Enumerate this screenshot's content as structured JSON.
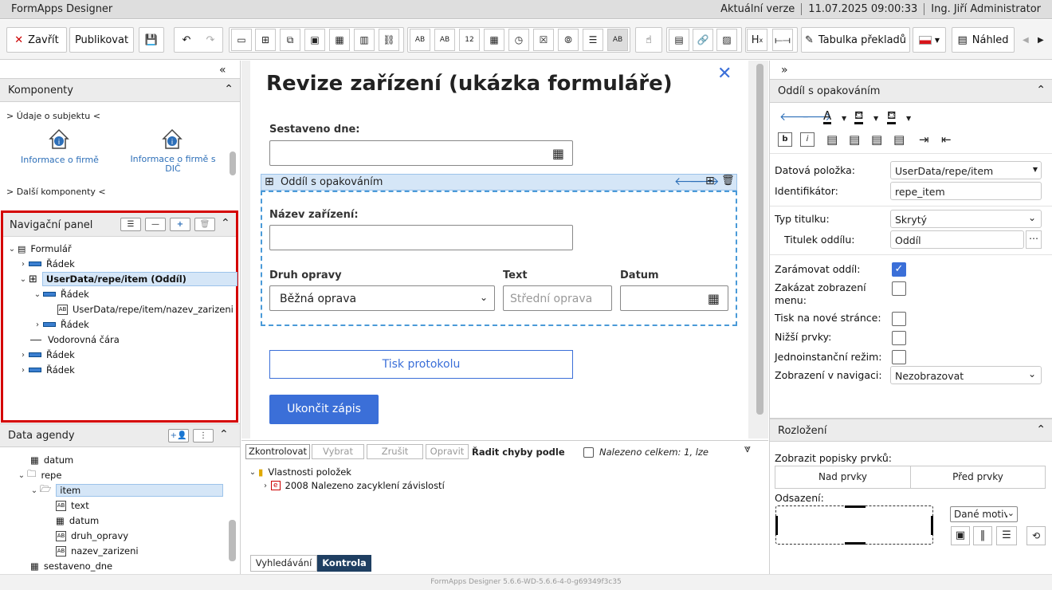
{
  "titlebar": {
    "app": "FormApps Designer",
    "version": "Aktuální verze",
    "datetime": "11.07.2025 09:00:33",
    "user": "Ing. Jiří Administrator"
  },
  "toolbar": {
    "close": "Zavřít",
    "publish": "Publikovat",
    "translations": "Tabulka překladů",
    "preview": "Náhled",
    "undo_icon": "undo-icon",
    "redo_icon": "redo-icon"
  },
  "components": {
    "title": "Komponenty",
    "group1": "> Údaje o subjektu <",
    "item1": "Informace o firmě",
    "item2": "Informace o firmě s DIČ",
    "group2": "> Další komponenty <"
  },
  "nav": {
    "title": "Navigační panel",
    "items": [
      "Formulář",
      "Řádek",
      "UserData/repe/item (Oddíl)",
      "Řádek",
      "UserData/repe/item/nazev_zarizeni",
      "Řádek",
      "Vodorovná čára",
      "Řádek",
      "Řádek"
    ]
  },
  "agenda": {
    "title": "Data agendy",
    "items": [
      "datum",
      "repe",
      "item",
      "text",
      "datum",
      "druh_opravy",
      "nazev_zarizeni",
      "sestaveno_dne"
    ]
  },
  "form": {
    "title": "Revize zařízení (ukázka formuláře)",
    "sestaveno": "Sestaveno dne:",
    "section": "Oddíl s opakováním",
    "nazev": "Název zařízení:",
    "druh": "Druh opravy",
    "druh_value": "Běžná oprava",
    "text_label": "Text",
    "text_placeholder": "Střední oprava",
    "datum": "Datum",
    "print": "Tisk protokolu",
    "finish": "Ukončit zápis"
  },
  "check": {
    "btn_check": "Zkontrolovat",
    "btn_select": "Vybrat",
    "btn_cancel": "Zrušit",
    "btn_fix": "Opravit",
    "sort": "Řadit chyby podle",
    "found": "Nalezeno celkem: 1, lze",
    "tree1": "Vlastnosti položek",
    "tree2": "2008 Nalezeno zacyklení závislostí",
    "tab_search": "Vyhledávání",
    "tab_check": "Kontrola"
  },
  "props": {
    "title": "Oddíl s opakováním",
    "data_label": "Datová položka:",
    "data_value": "UserData/repe/item",
    "id_label": "Identifikátor:",
    "id_value": "repe_item",
    "type_label": "Typ titulku:",
    "type_value": "Skrytý",
    "caption_label": "Titulek oddílu:",
    "caption_value": "Oddíl",
    "frame": "Zarámovat oddíl:",
    "hide_menu": "Zakázat zobrazení menu:",
    "print_new": "Tisk na nové stránce:",
    "lower": "Nižší prvky:",
    "single": "Jednoinstanční režim:",
    "nav_display": "Zobrazení v navigaci:",
    "nav_value": "Nezobrazovat",
    "frame_checked": true
  },
  "layout": {
    "title": "Rozložení",
    "show_labels": "Zobrazit popisky prvků:",
    "above": "Nad prvky",
    "before": "Před prvky",
    "indent": "Odsazení:",
    "motive": "Dané motiv"
  },
  "footer": "FormApps Designer 5.6.6-WD-5.6.6-4-0-g69349f3c35",
  "colors": {
    "accent": "#3b6fd8",
    "highlight": "#d40000",
    "section_bg": "#d5e6f7"
  }
}
